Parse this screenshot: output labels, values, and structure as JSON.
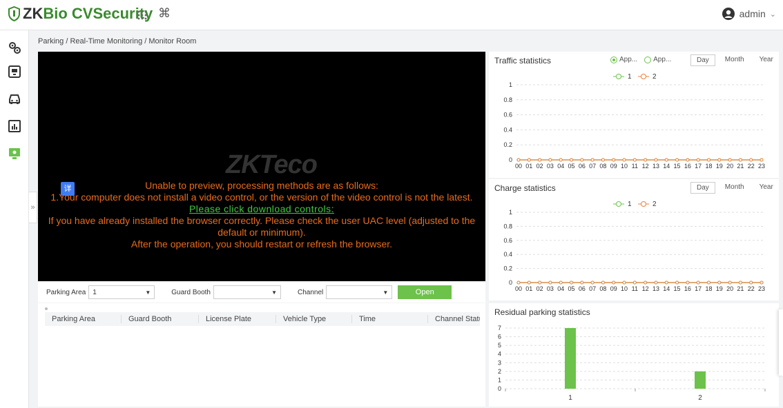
{
  "header": {
    "brand_prefix": "ZK",
    "brand_suffix": "Bio CVSecurity",
    "cmd_symbol": "⌘",
    "user": "admin",
    "user_caret": "⌄"
  },
  "nav": {
    "collapse_symbol": "»"
  },
  "breadcrumb": "Parking / Real-Time Monitoring / Monitor Room",
  "video": {
    "watermark": "ZKTeco",
    "badge": "详",
    "lines": [
      "Unable to preview, processing methods are as follows:",
      "1.Your computer does not install a video control, or the version of the video control is not the latest.",
      "Please click download controls:",
      "If you have already installed the browser correctly. Please check the user UAC level (adjusted to the",
      "default or minimum).",
      "After the operation, you should restart or refresh the browser."
    ]
  },
  "filters": {
    "parking_area_label": "Parking Area",
    "parking_area_value": "1",
    "guard_booth_label": "Guard Booth",
    "guard_booth_value": "",
    "channel_label": "Channel",
    "channel_value": "",
    "open_label": "Open"
  },
  "table": {
    "columns": [
      "Parking Area",
      "Guard Booth",
      "License Plate",
      "Vehicle Type",
      "Time",
      "Channel Statu"
    ]
  },
  "traffic": {
    "title": "Traffic statistics",
    "radio1": "App...",
    "radio2": "App...",
    "periods": [
      "Day",
      "Month",
      "Year"
    ],
    "legend": [
      "1",
      "2"
    ]
  },
  "charge": {
    "title": "Charge statistics",
    "periods": [
      "Day",
      "Month",
      "Year"
    ],
    "legend": [
      "1",
      "2"
    ]
  },
  "residual": {
    "title": "Residual parking statistics"
  },
  "colors": {
    "green": "#6cc24a",
    "orange": "#e8803c",
    "accent": "#3a8a2e"
  },
  "chart_data": [
    {
      "type": "line",
      "title": "Traffic statistics",
      "x": [
        "00",
        "01",
        "02",
        "03",
        "04",
        "05",
        "06",
        "07",
        "08",
        "09",
        "10",
        "11",
        "12",
        "13",
        "14",
        "15",
        "16",
        "17",
        "18",
        "19",
        "20",
        "21",
        "22",
        "23"
      ],
      "ylim": [
        0,
        1
      ],
      "yticks": [
        "0",
        "0.2",
        "0.4",
        "0.6",
        "0.8",
        "1"
      ],
      "series": [
        {
          "name": "1",
          "values": [
            0,
            0,
            0,
            0,
            0,
            0,
            0,
            0,
            0,
            0,
            0,
            0,
            0,
            0,
            0,
            0,
            0,
            0,
            0,
            0,
            0,
            0,
            0,
            0
          ]
        },
        {
          "name": "2",
          "values": [
            0,
            0,
            0,
            0,
            0,
            0,
            0,
            0,
            0,
            0,
            0,
            0,
            0,
            0,
            0,
            0,
            0,
            0,
            0,
            0,
            0,
            0,
            0,
            0
          ]
        }
      ]
    },
    {
      "type": "line",
      "title": "Charge statistics",
      "x": [
        "00",
        "01",
        "02",
        "03",
        "04",
        "05",
        "06",
        "07",
        "08",
        "09",
        "10",
        "11",
        "12",
        "13",
        "14",
        "15",
        "16",
        "17",
        "18",
        "19",
        "20",
        "21",
        "22",
        "23"
      ],
      "ylim": [
        0,
        1
      ],
      "yticks": [
        "0",
        "0.2",
        "0.4",
        "0.6",
        "0.8",
        "1"
      ],
      "series": [
        {
          "name": "1",
          "values": [
            0,
            0,
            0,
            0,
            0,
            0,
            0,
            0,
            0,
            0,
            0,
            0,
            0,
            0,
            0,
            0,
            0,
            0,
            0,
            0,
            0,
            0,
            0,
            0
          ]
        },
        {
          "name": "2",
          "values": [
            0,
            0,
            0,
            0,
            0,
            0,
            0,
            0,
            0,
            0,
            0,
            0,
            0,
            0,
            0,
            0,
            0,
            0,
            0,
            0,
            0,
            0,
            0,
            0
          ]
        }
      ]
    },
    {
      "type": "bar",
      "title": "Residual parking statistics",
      "categories": [
        "1",
        "2"
      ],
      "values": [
        7,
        2
      ],
      "ylim": [
        0,
        7
      ],
      "yticks": [
        "0",
        "1",
        "2",
        "3",
        "4",
        "5",
        "6",
        "7"
      ]
    }
  ]
}
